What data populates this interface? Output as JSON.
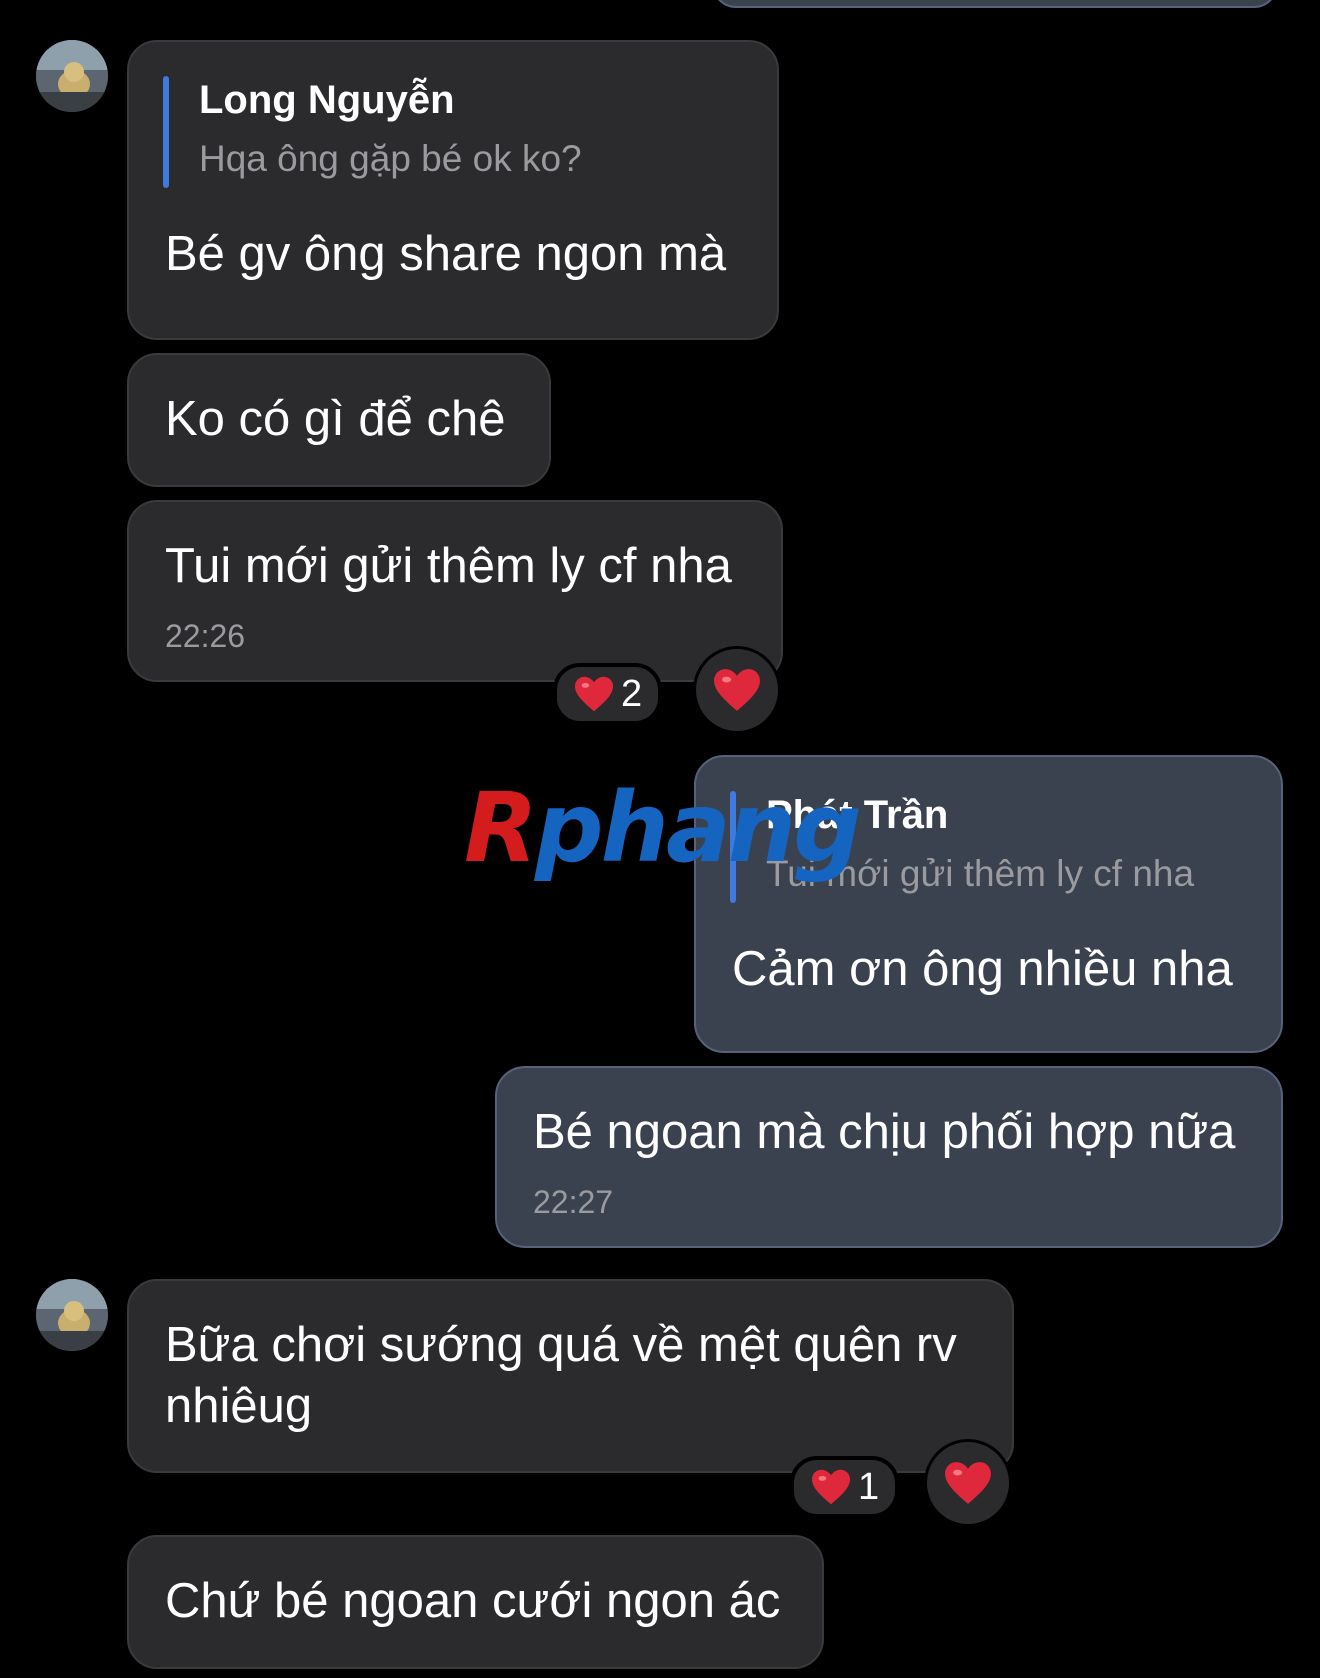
{
  "colors": {
    "background": "#000000",
    "incoming_bubble": "#2b2b2e",
    "outgoing_bubble": "#3a4250",
    "reply_bar": "#3e7be0",
    "secondary_text": "#9a9a9f",
    "heart": "#e0283c"
  },
  "icons": {
    "heart": "heart-icon",
    "avatar": "avatar-image"
  },
  "messages": {
    "m1": {
      "reply_author": "Long Nguyễn",
      "reply_quote": "Hqa ông gặp bé ok ko?",
      "text": "Bé gv ông share ngon mà"
    },
    "m2": {
      "text": "Ko có gì để chê"
    },
    "m3": {
      "text": "Tui mới gửi thêm ly cf nha",
      "time": "22:26",
      "reaction_count": "2"
    },
    "m4": {
      "reply_author": "Phát Trần",
      "reply_quote": "Tui mới gửi thêm ly cf nha",
      "text": "Cảm ơn ông nhiều nha"
    },
    "m5": {
      "text": "Bé ngoan mà chịu phối hợp nữa",
      "time": "22:27"
    },
    "m6": {
      "text_line1": "Bữa chơi sướng quá về mệt quên rv",
      "text_line2": "nhiêug",
      "reaction_count": "1"
    },
    "m7": {
      "text": "Chứ bé ngoan cưới ngon ác"
    }
  },
  "watermark": {
    "first": "R",
    "rest": "phang"
  }
}
